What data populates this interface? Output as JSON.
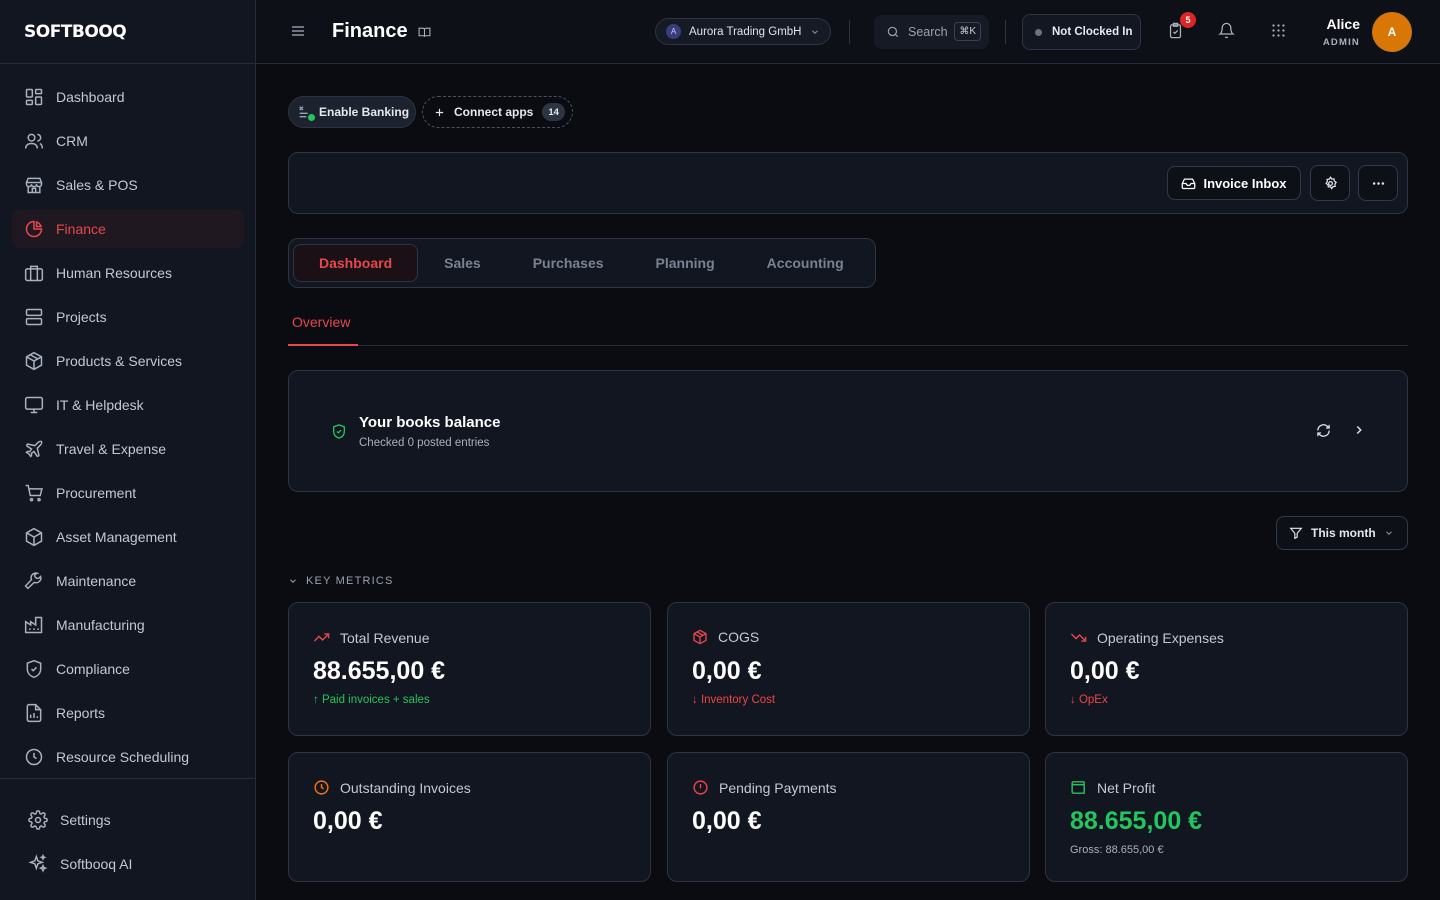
{
  "app": {
    "logo": "SOFTBOOQ"
  },
  "sidebar": {
    "items": [
      {
        "label": "Dashboard",
        "icon": "dashboard-icon"
      },
      {
        "label": "CRM",
        "icon": "users-icon"
      },
      {
        "label": "Sales & POS",
        "icon": "store-icon"
      },
      {
        "label": "Finance",
        "icon": "pie-chart-icon",
        "active": true
      },
      {
        "label": "Human Resources",
        "icon": "briefcase-icon"
      },
      {
        "label": "Projects",
        "icon": "projects-icon"
      },
      {
        "label": "Products & Services",
        "icon": "package-icon"
      },
      {
        "label": "IT & Helpdesk",
        "icon": "monitor-icon"
      },
      {
        "label": "Travel & Expense",
        "icon": "plane-icon"
      },
      {
        "label": "Procurement",
        "icon": "cart-icon"
      },
      {
        "label": "Asset Management",
        "icon": "box-icon"
      },
      {
        "label": "Maintenance",
        "icon": "wrench-icon"
      },
      {
        "label": "Manufacturing",
        "icon": "factory-icon"
      },
      {
        "label": "Compliance",
        "icon": "shield-icon"
      },
      {
        "label": "Reports",
        "icon": "report-icon"
      },
      {
        "label": "Resource Scheduling",
        "icon": "clock-icon"
      }
    ],
    "bottom": [
      {
        "label": "Settings",
        "icon": "gear-icon"
      },
      {
        "label": "Softbooq AI",
        "icon": "sparkles-icon"
      }
    ]
  },
  "header": {
    "title": "Finance",
    "company": {
      "initial": "A",
      "name": "Aurora Trading GmbH"
    },
    "search": {
      "label": "Search",
      "shortcut": "⌘K"
    },
    "clock_status": "Not Clocked In",
    "tasks_badge": "5",
    "user": {
      "name": "Alice",
      "role": "ADMIN",
      "initial": "A"
    }
  },
  "actions": {
    "enable_banking": "Enable Banking",
    "connect_apps": "Connect apps",
    "connect_apps_count": "14",
    "invoice_inbox": "Invoice Inbox"
  },
  "tabs": [
    {
      "label": "Dashboard",
      "active": true
    },
    {
      "label": "Sales"
    },
    {
      "label": "Purchases"
    },
    {
      "label": "Planning"
    },
    {
      "label": "Accounting"
    }
  ],
  "subtab": "Overview",
  "balance": {
    "title": "Your books balance",
    "subtitle": "Checked 0 posted entries"
  },
  "filter": "This month",
  "metrics": {
    "heading": "KEY METRICS",
    "cards": [
      {
        "label": "Total Revenue",
        "value": "88.655,00 €",
        "sub": "↑ Paid invoices + sales",
        "icon": "trend-up-icon",
        "color": "#22c55e"
      },
      {
        "label": "COGS",
        "value": "0,00 €",
        "sub": "↓ Inventory Cost",
        "icon": "package-icon",
        "color": "#ef4444"
      },
      {
        "label": "Operating Expenses",
        "value": "0,00 €",
        "sub": "↓ OpEx",
        "icon": "trend-down-icon",
        "color": "#ef4444"
      },
      {
        "label": "Outstanding Invoices",
        "value": "0,00 €",
        "icon": "clock-icon",
        "color": "#f97316"
      },
      {
        "label": "Pending Payments",
        "value": "0,00 €",
        "icon": "alert-circle-icon",
        "color": "#ef4444"
      },
      {
        "label": "Net Profit",
        "value": "88.655,00 €",
        "sub": "Gross: 88.655,00 €",
        "icon": "wallet-icon",
        "color": "#22c55e"
      }
    ]
  },
  "colors": {
    "accent": "#e5484d",
    "positive": "#22c55e",
    "negative": "#ef4444",
    "warning": "#f97316",
    "avatar": "#d97706"
  }
}
